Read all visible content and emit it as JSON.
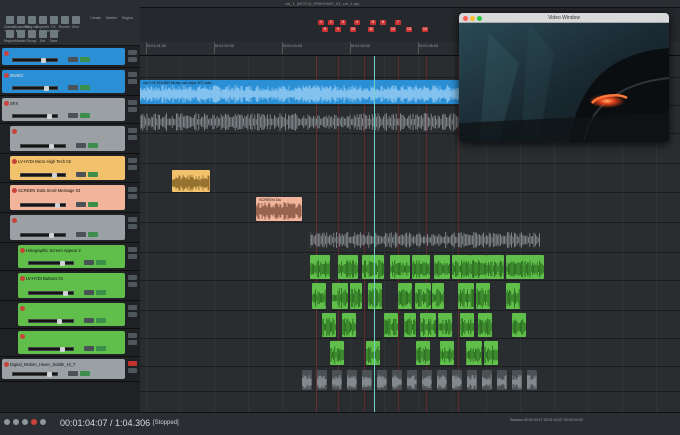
{
  "project_title": "vid_1_(MOTO)_FINISHING_01_cut_1.rpp",
  "toolbar": {
    "buttons": [
      "Classic mixer",
      "Snapshot library",
      "Plug-ins",
      "Explorer",
      "FX browser",
      "Render",
      "Glue",
      "Region",
      "Marker",
      "Group",
      "Set",
      "Save"
    ],
    "right_labels": [
      "Create",
      "Marker",
      "Region"
    ]
  },
  "ruler": [
    "00:01:01:00",
    "00:01:02:00",
    "00:01:03:00",
    "00:01:04:00",
    "00:01:05:00",
    "00:01:06:00",
    "00:01:07:00",
    "00:01:08:00",
    "00:01:09:00"
  ],
  "markers": [
    "1",
    "2",
    "3",
    "4",
    "5",
    "6",
    "7",
    "8",
    "9",
    "10",
    "11",
    "12",
    "13",
    "14"
  ],
  "tracks": [
    {
      "name": "",
      "color": "#2b8fd6"
    },
    {
      "name": "MUSIC",
      "color": "#2b8fd6"
    },
    {
      "name": "SFX",
      "color": "#9aa0a4"
    },
    {
      "name": "",
      "color": "#9aa0a4"
    },
    {
      "name": "LV-HYDI Micro High Tech 02",
      "color": "#f1c26b"
    },
    {
      "name": "SCREEN Data Send Message 03",
      "color": "#f2b49a"
    },
    {
      "name": "",
      "color": "#9aa0a4"
    },
    {
      "name": "Holographic Screen Appear 2",
      "color": "#5fbf4a"
    },
    {
      "name": "LV-HYDI Buttons 01",
      "color": "#5fbf4a"
    },
    {
      "name": "",
      "color": "#5fbf4a"
    },
    {
      "name": "",
      "color": "#5fbf4a"
    },
    {
      "name": "Digital_Motion_Hover_Subtle_Hi_7",
      "color": "#9aa0a4"
    }
  ],
  "clips": {
    "music": "vid 1+4 SOUND Music cut copy 007.wav",
    "sfx_screen": "SCREEN Da"
  },
  "video_window": {
    "title": "Video Window"
  },
  "transport": {
    "time": "00:01:04:07 / 1:04.306",
    "state": "[Stopped]",
    "status_left": "RPS: Tal",
    "bpm_info": "Session  00:01:00:17   00:01:04:07  00:00:04:00"
  }
}
